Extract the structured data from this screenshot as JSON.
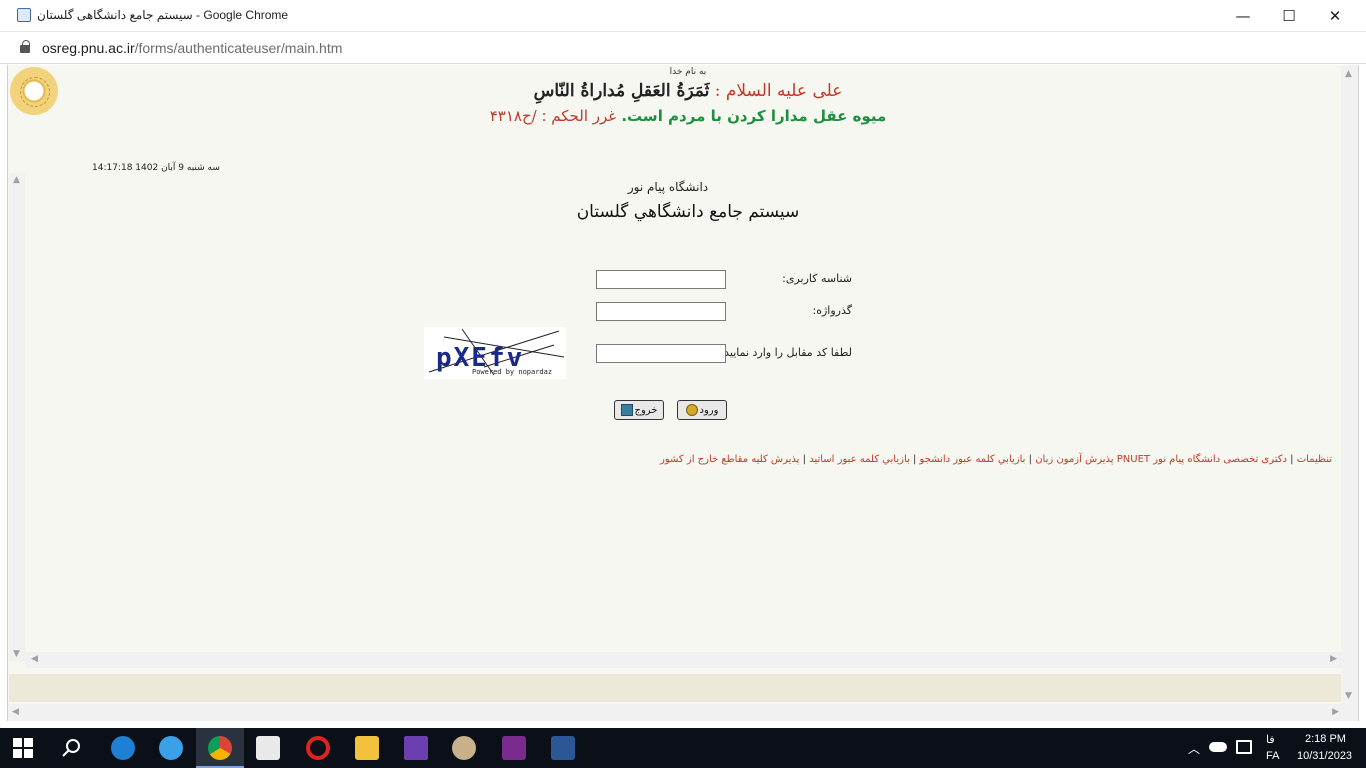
{
  "browser": {
    "window_title": "سیستم جامع دانشگاهی گلستان - Google Chrome",
    "url_host": "osreg.pnu.ac.ir",
    "url_path": "/forms/authenticateuser/main.htm"
  },
  "header": {
    "bismillah": "به نام خدا",
    "hadith_attribution": "علی علیه السلام :",
    "hadith_text": "ثَمَرَةُ العَقلِ مُداراةُ النّاسِ",
    "translation": "میوه عقل مدارا کردن با مردم است.",
    "source": "غرر الحکم : /ح۴۳۱۸",
    "datetime": "14:17:18 سه شنبه 9 آبان 1402"
  },
  "login": {
    "university": "دانشگاه پیام نور",
    "system_name": "سيستم جامع دانشگاهي گلستان",
    "username_label": "شناسه کاربری:",
    "password_label": "گذرواژه:",
    "captcha_label": "لطفا کد مقابل را وارد نمایید:",
    "captcha_text": "pXEfv",
    "captcha_small": "Powered by nopardaz",
    "login_button": "ورود",
    "exit_button": "خروج"
  },
  "links": [
    "تنظیمات",
    "دکتری تخصصی دانشگاه پیام نور PNUET",
    "پذیرش آزمون زبان",
    "بازيابي كلمه عبور دانشجو",
    "بازيابي كلمه عبور اساتيد",
    "پذيرش كليه مقاطع خارج از كشور"
  ],
  "taskbar": {
    "time": "2:18 PM",
    "date": "10/31/2023",
    "lang_top": "فا",
    "lang_bottom": "FA"
  },
  "colors": {
    "page_bg": "#f7f7f1",
    "link_red": "#c0392b",
    "translation_green": "#1e8f3e"
  }
}
